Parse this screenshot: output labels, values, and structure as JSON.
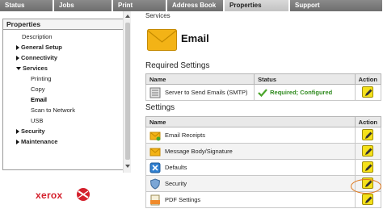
{
  "tabs": [
    {
      "label": "Status",
      "active": false
    },
    {
      "label": "Jobs",
      "active": false
    },
    {
      "label": "Print",
      "active": false
    },
    {
      "label": "Address Book",
      "active": false
    },
    {
      "label": "Properties",
      "active": true
    },
    {
      "label": "Support",
      "active": false
    }
  ],
  "sidebar": {
    "title": "Properties",
    "items": [
      {
        "label": "Description",
        "expander": "none"
      },
      {
        "label": "General Setup",
        "expander": "collapsed"
      },
      {
        "label": "Connectivity",
        "expander": "collapsed"
      },
      {
        "label": "Services",
        "expander": "expanded"
      },
      {
        "label": "Printing",
        "expander": "none"
      },
      {
        "label": "Copy",
        "expander": "none"
      },
      {
        "label": "Email",
        "expander": "none",
        "selected": true
      },
      {
        "label": "Scan to Network",
        "expander": "none"
      },
      {
        "label": "USB",
        "expander": "none"
      },
      {
        "label": "Security",
        "expander": "collapsed"
      },
      {
        "label": "Maintenance",
        "expander": "collapsed"
      }
    ]
  },
  "logo": {
    "text": "xerox"
  },
  "content": {
    "breadcrumb": "Services",
    "title": "Email",
    "required_heading": "Required Settings",
    "required_columns": [
      "Name",
      "Status",
      "Action"
    ],
    "required_rows": [
      {
        "name": "Server to Send Emails (SMTP)",
        "status": "Required; Configured",
        "icon": "server-icon"
      }
    ],
    "settings_heading": "Settings",
    "settings_columns": [
      "Name",
      "Action"
    ],
    "settings_rows": [
      {
        "name": "Email Receipts",
        "icon": "email-receipts-icon"
      },
      {
        "name": "Message Body/Signature",
        "icon": "message-body-icon"
      },
      {
        "name": "Defaults",
        "icon": "defaults-icon"
      },
      {
        "name": "Security",
        "icon": "shield-icon"
      },
      {
        "name": "PDF Settings",
        "icon": "pdf-icon"
      }
    ]
  },
  "colors": {
    "tab_bg": "#7a7a7a",
    "tab_active_bg": "#cfcfcf",
    "status_ok": "#2f8a1e",
    "edit_button": "#f5e11a",
    "logo_red": "#d4202c",
    "highlight": "#e07a1f"
  }
}
